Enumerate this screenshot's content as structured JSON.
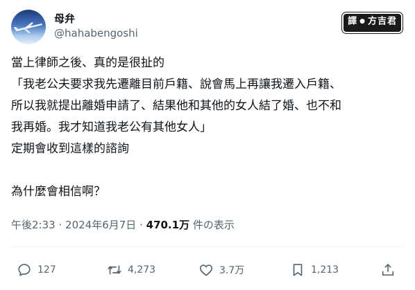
{
  "user": {
    "display_name": "母弁",
    "handle": "@hahabengoshi"
  },
  "watermark": {
    "part1": "譯",
    "part2": "方吉君"
  },
  "post": {
    "lines": [
      "當上律師之後、真的是很扯的",
      "「我老公夫要求我先遷離目前戶籍、說會馬上再讓我遷入戶籍、",
      "所以我就提出離婚申請了、結果他和其他的女人結了婚、也不和",
      "我再婚。我才知道我老公有其他女人」",
      "定期會收到這樣的諮詢",
      "",
      "為什麼會相信啊？"
    ]
  },
  "meta": {
    "time": "午後2:33",
    "separator": "·",
    "date": "2024年6月7日",
    "views_number": "470.1万",
    "views_label": "件の表示"
  },
  "actions": {
    "reply_count": "127",
    "repost_count": "4,273",
    "like_count": "3.7万",
    "bookmark_count": "1,213"
  },
  "icons": {
    "reply": "reply-icon",
    "repost": "repost-icon",
    "like": "heart-icon",
    "bookmark": "bookmark-icon",
    "share": "share-icon"
  },
  "colors": {
    "text": "#0f1419",
    "secondary": "#536471",
    "divider": "#eff3f4"
  }
}
